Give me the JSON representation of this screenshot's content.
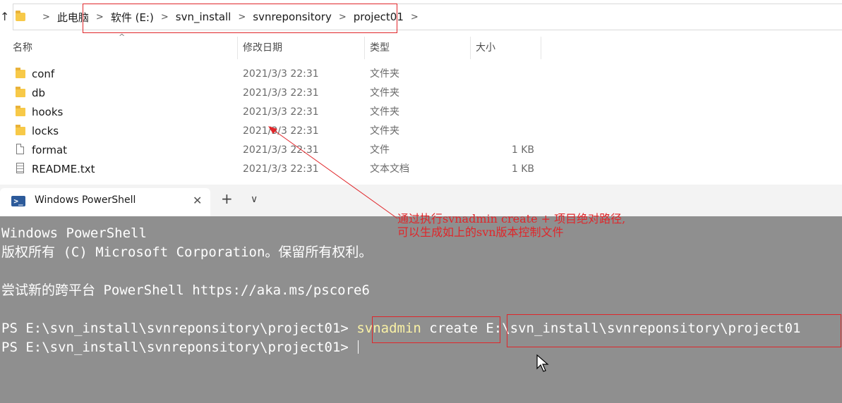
{
  "explorer": {
    "breadcrumb": [
      "此电脑",
      "软件 (E:)",
      "svn_install",
      "svnreponsitory",
      "project01"
    ],
    "columns": {
      "name": "名称",
      "date": "修改日期",
      "type": "类型",
      "size": "大小"
    },
    "files": [
      {
        "name": "conf",
        "date": "2021/3/3 22:31",
        "type": "文件夹",
        "size": "",
        "icon": "folder-icon"
      },
      {
        "name": "db",
        "date": "2021/3/3 22:31",
        "type": "文件夹",
        "size": "",
        "icon": "folder-icon"
      },
      {
        "name": "hooks",
        "date": "2021/3/3 22:31",
        "type": "文件夹",
        "size": "",
        "icon": "folder-icon"
      },
      {
        "name": "locks",
        "date": "2021/3/3 22:31",
        "type": "文件夹",
        "size": "",
        "icon": "folder-icon"
      },
      {
        "name": "format",
        "date": "2021/3/3 22:31",
        "type": "文件",
        "size": "1 KB",
        "icon": "file-icon"
      },
      {
        "name": "README.txt",
        "date": "2021/3/3 22:31",
        "type": "文本文档",
        "size": "1 KB",
        "icon": "text-file-icon"
      }
    ]
  },
  "terminal": {
    "tab_title": "Windows PowerShell",
    "lines": {
      "l1": "Windows PowerShell",
      "l2": "版权所有 (C) Microsoft Corporation。保留所有权利。",
      "l3": "尝试新的跨平台 PowerShell https://aka.ms/pscore6",
      "prompt": "PS E:\\svn_install\\svnreponsitory\\project01> ",
      "cmd_name": "svnadmin",
      "cmd_arg": " create ",
      "cmd_path": "E:\\svn_install\\svnreponsitory\\project01"
    }
  },
  "annotation": {
    "line1": "通过执行svnadmin create + 项目绝对路径,",
    "line2": "可以生成如上的svn版本控制文件"
  },
  "colors": {
    "highlight": "#e0262a",
    "terminal_bg": "#8f8f8f",
    "command_yellow": "#f9f1a5",
    "folder": "#f7c948"
  }
}
